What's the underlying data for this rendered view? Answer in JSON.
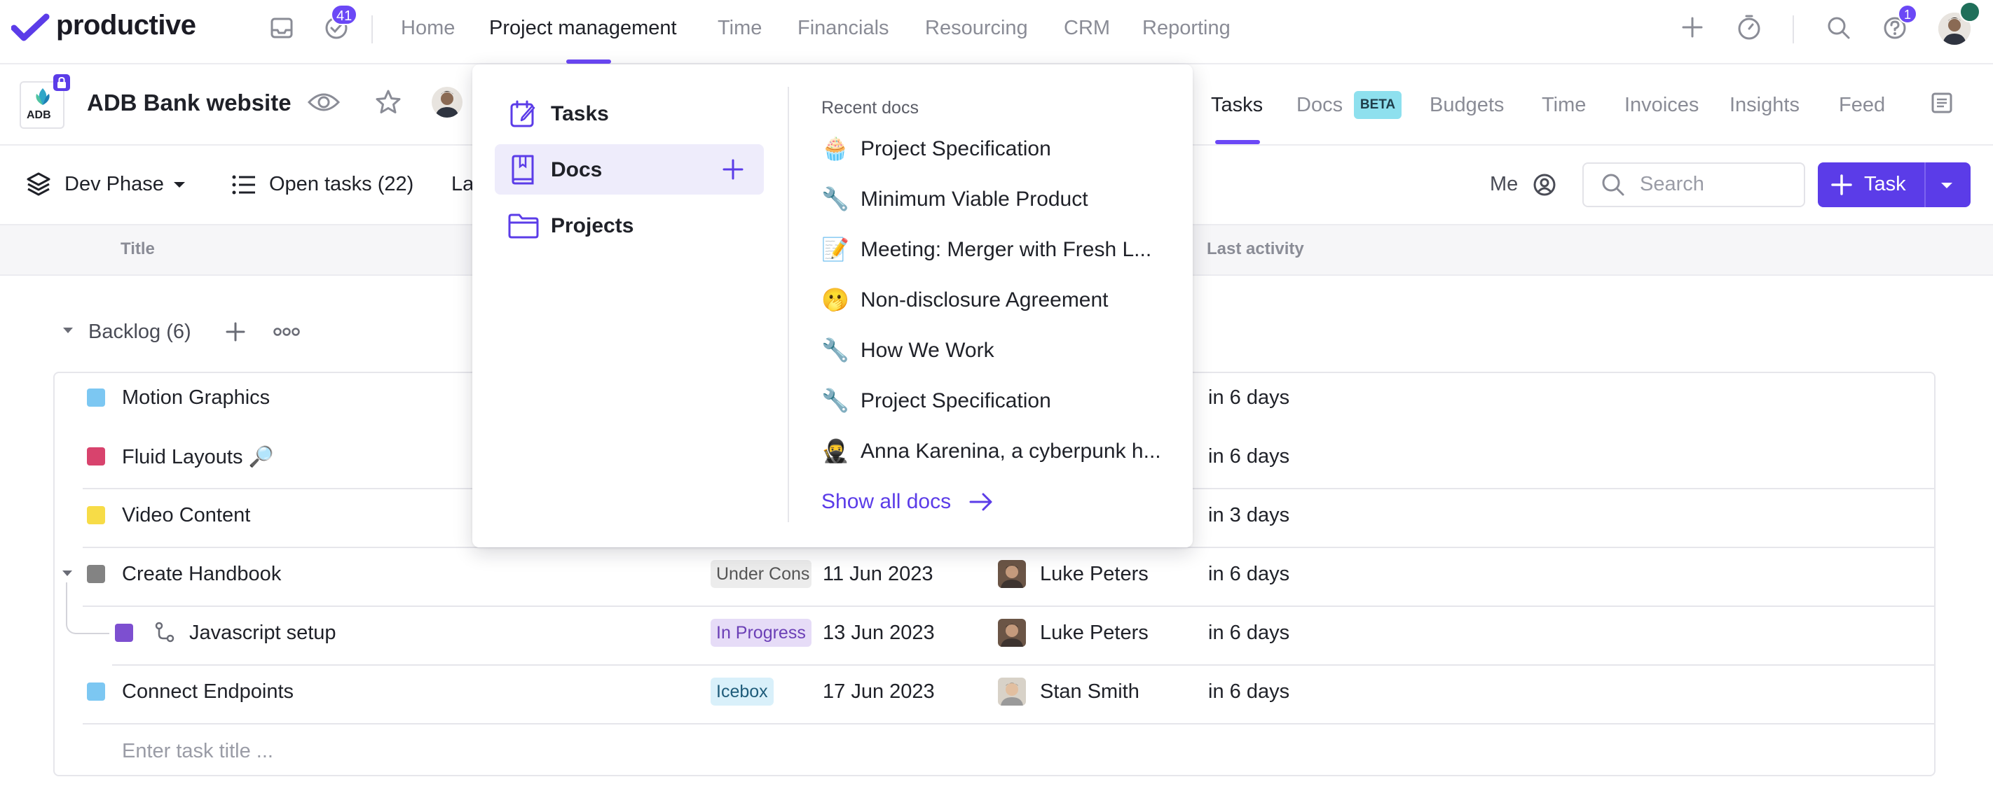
{
  "colors": {
    "accent": "#6b48f6",
    "primary_button": "#5b3ce8"
  },
  "topnav": {
    "brand": "productive",
    "notifications_badge": "41",
    "links": [
      "Home",
      "Project management",
      "Time",
      "Financials",
      "Resourcing",
      "CRM",
      "Reporting"
    ],
    "active_link": "Project management",
    "help_badge": "1"
  },
  "project": {
    "title": "ADB Bank website",
    "logo_text": "ADB",
    "tabs": [
      "Tasks",
      "Docs",
      "Budgets",
      "Time",
      "Invoices",
      "Insights",
      "Feed"
    ],
    "active_tab": "Tasks",
    "docs_badge": "BETA"
  },
  "toolbar": {
    "phase": "Dev Phase",
    "open_tasks": "Open tasks (22)",
    "truncated": "La",
    "me_label": "Me",
    "search_placeholder": "Search",
    "task_button": "Task"
  },
  "columns": {
    "title": "Title",
    "last_activity": "Last activity"
  },
  "group": {
    "label": "Backlog (6)"
  },
  "rows": [
    {
      "title": "Motion Graphics",
      "color": "#7cc7f2",
      "last_activity": "in 6 days"
    },
    {
      "title": "Fluid Layouts 🔎",
      "color": "#d8436d",
      "last_activity": "in 6 days"
    },
    {
      "title": "Video Content",
      "color": "#f7dc47",
      "last_activity": "in 3 days"
    },
    {
      "title": "Create Handbook",
      "color": "#838383",
      "status": "Under Cons",
      "date": "11 Jun 2023",
      "assignee": "Luke Peters",
      "last_activity": "in 6 days"
    },
    {
      "title": "Javascript setup",
      "color": "#7d4fd0",
      "status": "In Progress",
      "date": "13 Jun 2023",
      "assignee": "Luke Peters",
      "last_activity": "in 6 days"
    },
    {
      "title": "Connect Endpoints",
      "color": "#7cc7f2",
      "status": "Icebox",
      "date": "17 Jun 2023",
      "assignee": "Stan Smith",
      "last_activity": "in 6 days"
    }
  ],
  "new_task_placeholder": "Enter task title ...",
  "dropdown": {
    "items": [
      "Tasks",
      "Docs",
      "Projects"
    ],
    "active_item": "Docs",
    "recent_heading": "Recent docs",
    "recent_docs": [
      {
        "emoji": "🧁",
        "title": "Project Specification"
      },
      {
        "emoji": "🔧",
        "title": "Minimum Viable Product"
      },
      {
        "emoji": "📝",
        "title": "Meeting: Merger with Fresh L..."
      },
      {
        "emoji": "🫢",
        "title": "Non-disclosure Agreement"
      },
      {
        "emoji": "🔧",
        "title": "How We Work"
      },
      {
        "emoji": "🔧",
        "title": "Project Specification"
      },
      {
        "emoji": "🥷",
        "title": "Anna Karenina, a cyberpunk h..."
      }
    ],
    "show_all": "Show all docs"
  }
}
